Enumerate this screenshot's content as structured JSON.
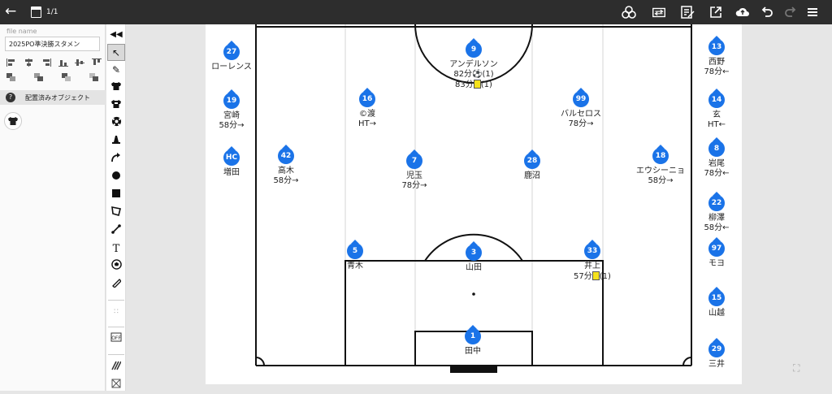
{
  "topbar": {
    "back_icon": "arrow-left-icon",
    "page_counter": "1/1",
    "icons": [
      "circles-icon",
      "swap-players-icon",
      "edit-note-icon",
      "share-icon",
      "cloud-upload-icon",
      "undo-icon",
      "redo-icon",
      "menu-icon"
    ]
  },
  "left_panel": {
    "file_name_label": "file name",
    "file_name_value": "2025PO準決勝スタメン",
    "placed_objects_label": "配置済みオブジェクト"
  },
  "toolbar": {
    "tools": [
      "collapse-icon",
      "cursor-icon",
      "pen-icon",
      "shirt-dark-icon",
      "shirt-icon",
      "ball-icon",
      "cone-icon",
      "curve-arrow-icon",
      "circle-icon",
      "square-icon",
      "polygon-icon",
      "line-icon",
      "text-icon",
      "ball-alt-icon",
      "ruler-icon",
      "formation-icon",
      "offside-icon",
      "pattern-icon",
      "grid-icon"
    ]
  },
  "colors": {
    "badge": "#1a73e8",
    "topbar": "#2d2d2d",
    "yellow_card": "#f5e21b"
  },
  "starters": [
    {
      "id": "p9",
      "number": "9",
      "name": "アンデルソン",
      "line2": "82分⚽(1)",
      "line3": "83分",
      "line3_card": true,
      "line3_suffix": "(1)"
    },
    {
      "id": "p16",
      "number": "16",
      "name": "©渡",
      "line2": "HT→"
    },
    {
      "id": "p99",
      "number": "99",
      "name": "バルセロス",
      "line2": "78分→"
    },
    {
      "id": "p42",
      "number": "42",
      "name": "高木",
      "line2": "58分→"
    },
    {
      "id": "p7",
      "number": "7",
      "name": "児玉",
      "line2": "78分→"
    },
    {
      "id": "p28",
      "number": "28",
      "name": "鹿沼"
    },
    {
      "id": "p18",
      "number": "18",
      "name": "エウシーニョ",
      "line2": "58分→"
    },
    {
      "id": "p5",
      "number": "5",
      "name": "青木"
    },
    {
      "id": "p3",
      "number": "3",
      "name": "山田"
    },
    {
      "id": "p33",
      "number": "33",
      "name": "井上",
      "line2": "57分",
      "line2_card": true,
      "line2_suffix": "(1)"
    },
    {
      "id": "p1",
      "number": "1",
      "name": "田中"
    }
  ],
  "bench_left": [
    {
      "id": "b27",
      "number": "27",
      "name": "ローレンス"
    },
    {
      "id": "b19",
      "number": "19",
      "name": "宮崎",
      "line2": "58分→"
    },
    {
      "id": "bhc",
      "number": "HC",
      "name": "増田"
    }
  ],
  "bench_right": [
    {
      "id": "b13",
      "number": "13",
      "name": "西野",
      "line2": "78分←"
    },
    {
      "id": "b14",
      "number": "14",
      "name": "玄",
      "line2": "HT←"
    },
    {
      "id": "b8",
      "number": "8",
      "name": "岩尾",
      "line2": "78分←"
    },
    {
      "id": "b22",
      "number": "22",
      "name": "柳澤",
      "line2": "58分←"
    },
    {
      "id": "b97",
      "number": "97",
      "name": "モヨ"
    },
    {
      "id": "b15",
      "number": "15",
      "name": "山越"
    },
    {
      "id": "b29",
      "number": "29",
      "name": "三井"
    }
  ]
}
